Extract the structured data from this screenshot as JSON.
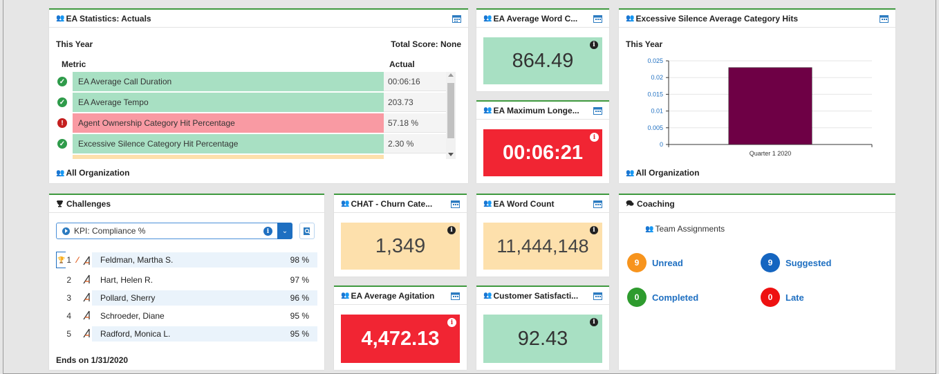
{
  "colors": {
    "accent_green": "#3f9a3f",
    "good": "#a8e0c3",
    "bad": "#f12533",
    "warn": "#fde0ac",
    "bar": "#6e0045",
    "link": "#1e6fc1"
  },
  "ea_stats": {
    "title": "EA Statistics: Actuals",
    "period": "This Year",
    "total_score": "Total Score: None",
    "col_metric": "Metric",
    "col_actual": "Actual",
    "rows": [
      {
        "name": "EA Average Call Duration",
        "value": "00:06:16",
        "status": "good",
        "icon": "check-icon"
      },
      {
        "name": "EA Average Tempo",
        "value": "203.73",
        "status": "good",
        "icon": "check-icon"
      },
      {
        "name": "Agent Ownership Category Hit Percentage",
        "value": "57.18 %",
        "status": "bad",
        "icon": "alert-icon"
      },
      {
        "name": "Excessive Silence Category Hit Percentage",
        "value": "2.30 %",
        "status": "good",
        "icon": "check-icon"
      }
    ],
    "footer": "All Organization"
  },
  "avg_word": {
    "title": "EA Average Word C...",
    "value": "864.49"
  },
  "max_longest": {
    "title": "EA Maximum Longe...",
    "value": "00:06:21"
  },
  "silence_chart": {
    "title": "Excessive Silence Average Category Hits",
    "period": "This Year",
    "footer": "All Organization"
  },
  "chart_data": {
    "type": "bar",
    "categories": [
      "Quarter 1 2020"
    ],
    "values": [
      0.023
    ],
    "ylim": [
      0,
      0.025
    ],
    "yticks": [
      "0",
      "0.005",
      "0.01",
      "0.015",
      "0.02",
      "0.025"
    ],
    "color": "#6e0045",
    "title": "",
    "xlabel": "",
    "ylabel": ""
  },
  "challenges": {
    "title": "Challenges",
    "kpi": "KPI: Compliance %",
    "leaderboard": [
      {
        "rank": "1",
        "name": "Feldman, Martha S.",
        "pct": "98 %"
      },
      {
        "rank": "2",
        "name": "Hart, Helen R.",
        "pct": "97 %"
      },
      {
        "rank": "3",
        "name": "Pollard, Sherry",
        "pct": "96 %"
      },
      {
        "rank": "4",
        "name": "Schroeder, Diane",
        "pct": "95 %"
      },
      {
        "rank": "5",
        "name": "Radford, Monica L.",
        "pct": "95 %"
      }
    ],
    "ends": "Ends on 1/31/2020"
  },
  "churn": {
    "title": "CHAT - Churn Cate...",
    "value": "1,349"
  },
  "agitation": {
    "title": "EA Average Agitation",
    "value": "4,472.13"
  },
  "word_count": {
    "title": "EA Word Count",
    "value": "11,444,148"
  },
  "csat": {
    "title": "Customer Satisfacti...",
    "value": "92.43"
  },
  "coaching": {
    "title": "Coaching",
    "subtitle": "Team Assignments",
    "items": [
      {
        "count": "9",
        "label": "Unread",
        "color": "#f7941d"
      },
      {
        "count": "9",
        "label": "Suggested",
        "color": "#1565c0"
      },
      {
        "count": "0",
        "label": "Completed",
        "color": "#2e9b2e"
      },
      {
        "count": "0",
        "label": "Late",
        "color": "#ee1111"
      }
    ]
  }
}
